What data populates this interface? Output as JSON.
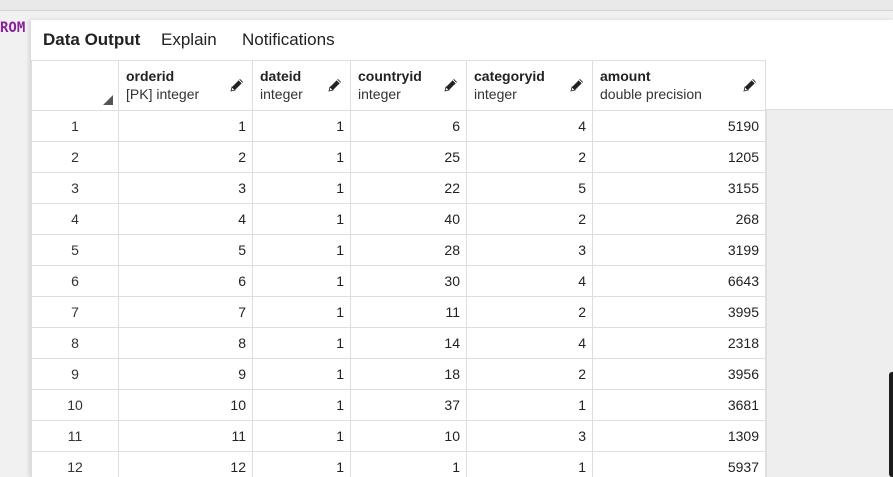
{
  "editor": {
    "sql_fragment": "ROM"
  },
  "tabs": [
    {
      "label": "Data Output",
      "active": true
    },
    {
      "label": "Explain",
      "active": false
    },
    {
      "label": "Notifications",
      "active": false
    }
  ],
  "columns": [
    {
      "name": "orderid",
      "type": "[PK] integer"
    },
    {
      "name": "dateid",
      "type": "integer"
    },
    {
      "name": "countryid",
      "type": "integer"
    },
    {
      "name": "categoryid",
      "type": "integer"
    },
    {
      "name": "amount",
      "type": "double precision"
    }
  ],
  "rows": [
    {
      "num": "1",
      "cells": [
        "1",
        "1",
        "6",
        "4",
        "5190"
      ]
    },
    {
      "num": "2",
      "cells": [
        "2",
        "1",
        "25",
        "2",
        "1205"
      ]
    },
    {
      "num": "3",
      "cells": [
        "3",
        "1",
        "22",
        "5",
        "3155"
      ]
    },
    {
      "num": "4",
      "cells": [
        "4",
        "1",
        "40",
        "2",
        "268"
      ]
    },
    {
      "num": "5",
      "cells": [
        "5",
        "1",
        "28",
        "3",
        "3199"
      ]
    },
    {
      "num": "6",
      "cells": [
        "6",
        "1",
        "30",
        "4",
        "6643"
      ]
    },
    {
      "num": "7",
      "cells": [
        "7",
        "1",
        "11",
        "2",
        "3995"
      ]
    },
    {
      "num": "8",
      "cells": [
        "8",
        "1",
        "14",
        "4",
        "2318"
      ]
    },
    {
      "num": "9",
      "cells": [
        "9",
        "1",
        "18",
        "2",
        "3956"
      ]
    },
    {
      "num": "10",
      "cells": [
        "10",
        "1",
        "37",
        "1",
        "3681"
      ]
    },
    {
      "num": "11",
      "cells": [
        "11",
        "1",
        "10",
        "3",
        "1309"
      ]
    },
    {
      "num": "12",
      "cells": [
        "12",
        "1",
        "1",
        "1",
        "5937"
      ]
    }
  ],
  "icons": {
    "edit_column": "pencil-icon",
    "select_all": "corner-triangle-icon"
  },
  "colors": {
    "sql_keyword": "#8b1f9b",
    "grid_border": "#dedede",
    "empty_area": "#eeeeee"
  }
}
